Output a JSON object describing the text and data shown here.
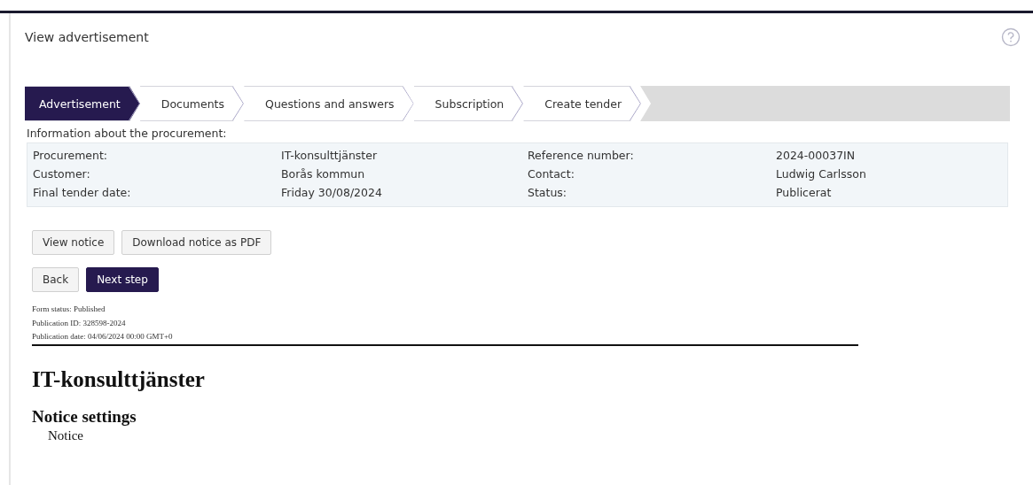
{
  "page": {
    "title": "View advertisement"
  },
  "steps": [
    {
      "label": "Advertisement",
      "selected": true
    },
    {
      "label": "Documents",
      "selected": false
    },
    {
      "label": "Questions and answers",
      "selected": false
    },
    {
      "label": "Subscription",
      "selected": false
    },
    {
      "label": "Create tender",
      "selected": false
    }
  ],
  "info": {
    "caption": "Information about the procurement:",
    "rows": [
      [
        {
          "label": "Procurement:",
          "value": "IT-konsulttjänster"
        },
        {
          "label": "Reference number:",
          "value": "2024-00037IN"
        }
      ],
      [
        {
          "label": "Customer:",
          "value": "Borås kommun"
        },
        {
          "label": "Contact:",
          "value": "Ludwig Carlsson"
        }
      ],
      [
        {
          "label": "Final tender date:",
          "value": "Friday 30/08/2024"
        },
        {
          "label": "Status:",
          "value": "Publicerat"
        }
      ]
    ]
  },
  "notice_buttons": [
    {
      "label": "View notice",
      "kind": "default"
    },
    {
      "label": "Download notice as PDF",
      "kind": "default"
    }
  ],
  "nav_buttons": [
    {
      "label": "Back",
      "kind": "default"
    },
    {
      "label": "Next step",
      "kind": "primary"
    }
  ],
  "form_meta": [
    "Form status: Published",
    "Publication ID: 328598-2024",
    "Publication date: 04/06/2024 00:00 GMT+0"
  ],
  "document": {
    "heading": "IT-konsulttjänster",
    "section": "Notice settings",
    "item": "Notice"
  }
}
